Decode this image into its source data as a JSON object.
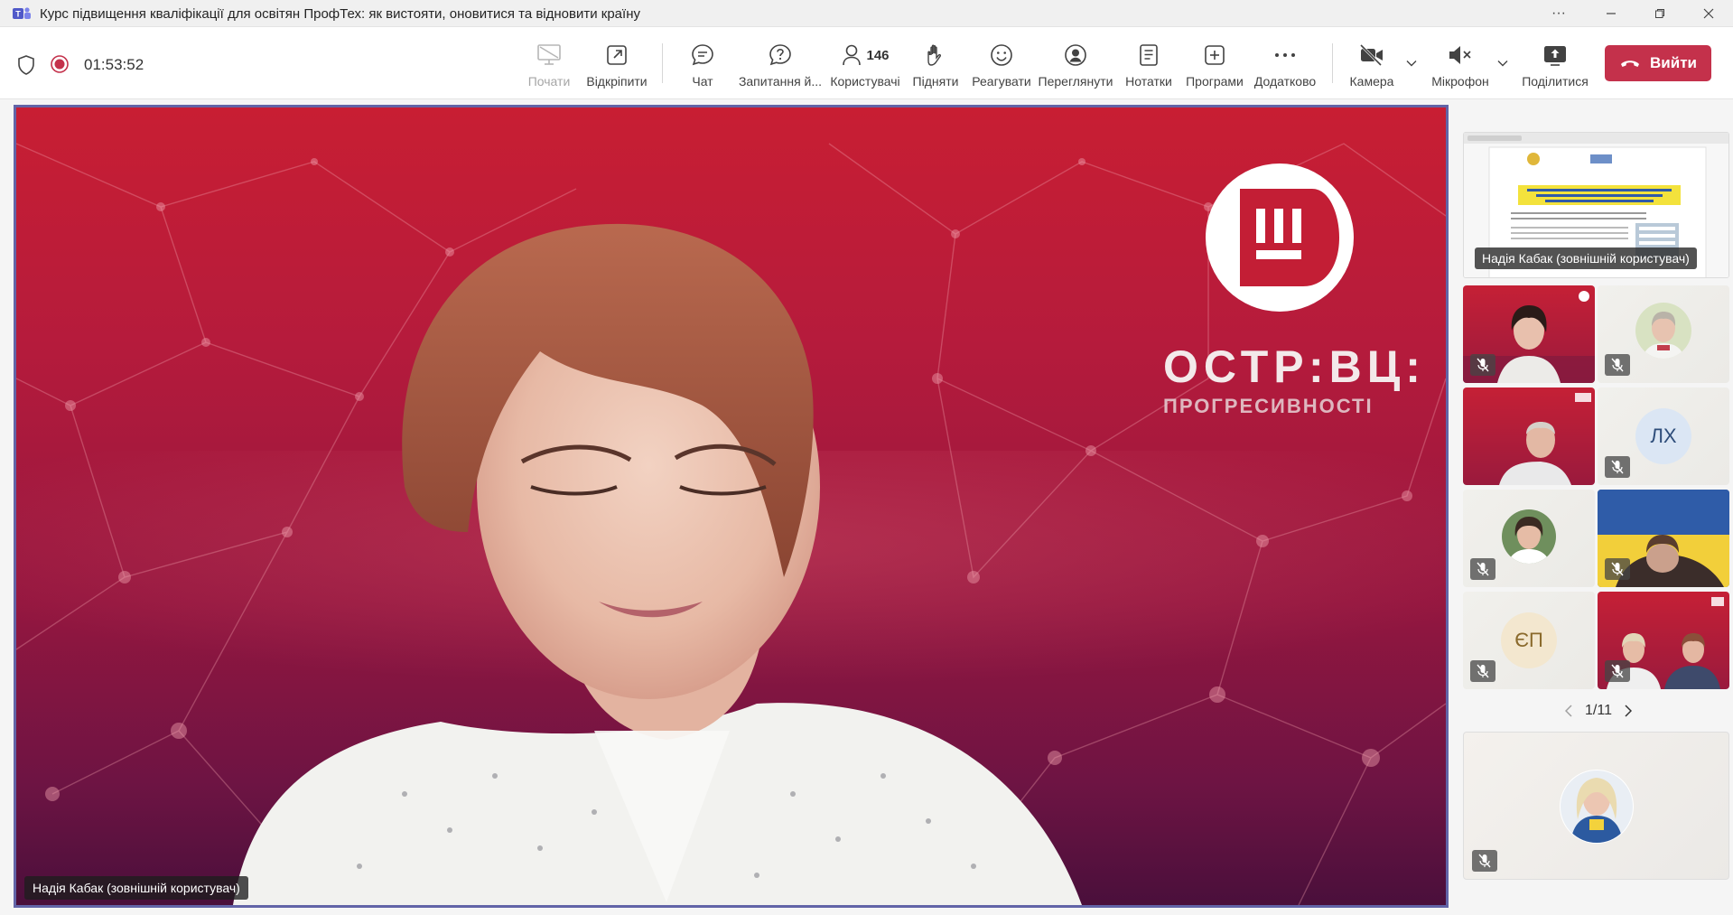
{
  "window": {
    "title": "Курс підвищення кваліфікації для освітян ПрофТех: як вистояти, оновитися та відновити країну",
    "controls": [
      "more",
      "minimize",
      "restore",
      "close"
    ]
  },
  "meeting": {
    "timer": "01:53:52",
    "participants_count": "146",
    "toolbar": {
      "start": "Почати",
      "open": "Відкріпити",
      "chat": "Чат",
      "qa": "Запитання й...",
      "people": "Користувачі",
      "raise": "Підняти",
      "react": "Реагувати",
      "view": "Переглянути",
      "notes": "Нотатки",
      "apps": "Програми",
      "more": "Додатково",
      "camera": "Камера",
      "mic": "Мікрофон",
      "share": "Поділитися",
      "leave": "Вийти"
    }
  },
  "stage": {
    "speaker_label": "Надія Кабак (зовнішній користувач)",
    "background_brand_line1": "ОСТР:ВЦ:",
    "background_brand_line2": "ПРОГРЕСИВНОСТІ"
  },
  "sidebar": {
    "shared_screen_label": "Надія Кабак (зовнішній користувач)",
    "participants": [
      {
        "type": "video",
        "muted": true
      },
      {
        "type": "photo",
        "muted": true
      },
      {
        "type": "video",
        "muted": false
      },
      {
        "type": "initials",
        "initials": "ЛХ",
        "muted": true,
        "color": "#dbe6f4"
      },
      {
        "type": "photo",
        "muted": true
      },
      {
        "type": "video",
        "muted": true
      },
      {
        "type": "initials",
        "initials": "ЄП",
        "muted": true,
        "color": "#f3e7cf"
      },
      {
        "type": "video",
        "muted": true
      }
    ],
    "pager": "1/11",
    "colors": {
      "accent": "#6264a7",
      "leave": "#c4314b",
      "stage_red": "#c81e33"
    }
  }
}
